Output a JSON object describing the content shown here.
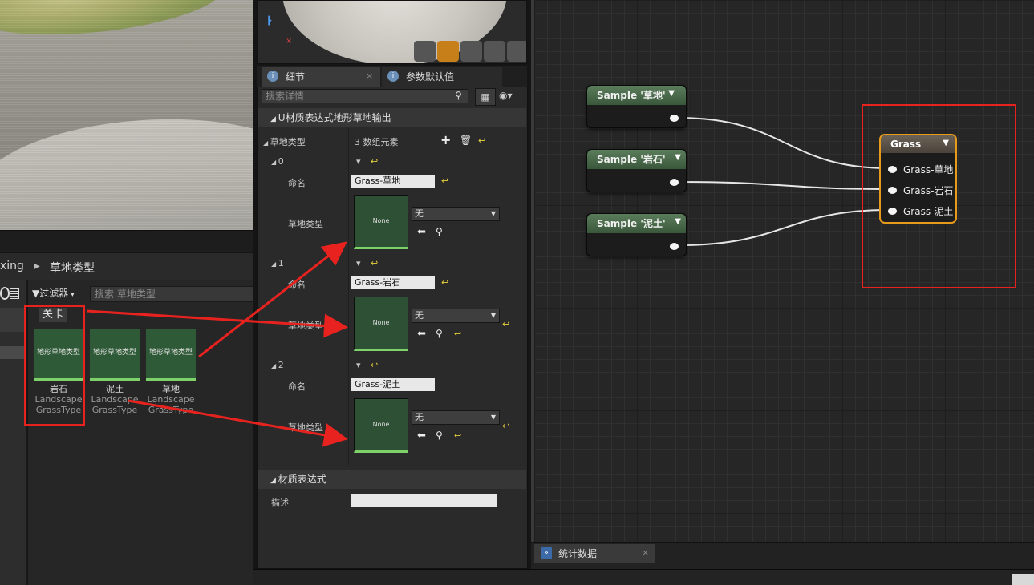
{
  "content_browser": {
    "path_prev": "xing",
    "path_current": "草地类型",
    "filter_label": "过滤器",
    "search_placeholder": "搜索 草地类型",
    "folder_tag": "关卡",
    "assets": [
      {
        "thumb_label": "地形草地类型",
        "name": "岩石",
        "type1": "Landscape",
        "type2": "GrassType"
      },
      {
        "thumb_label": "地形草地类型",
        "name": "泥土",
        "type1": "Landscape",
        "type2": "GrassType"
      },
      {
        "thumb_label": "地形草地类型",
        "name": "草地",
        "type1": "Landscape",
        "type2": "GrassType"
      }
    ]
  },
  "tabs": {
    "details": "细节",
    "defaults": "参数默认值"
  },
  "details": {
    "search_placeholder": "搜索详情",
    "section_title": "U材质表达式地形草地输出",
    "grass_types_label": "草地类型",
    "array_count": "3 数组元素",
    "name_label": "命名",
    "grass_type_label": "草地类型",
    "none_label": "None",
    "combo_value": "无",
    "elements": [
      {
        "index": "0",
        "name": "Grass-草地"
      },
      {
        "index": "1",
        "name": "Grass-岩石"
      },
      {
        "index": "2",
        "name": "Grass-泥土"
      }
    ],
    "material_section": "材质表达式",
    "desc_label": "描述"
  },
  "graph": {
    "sample_nodes": [
      "Sample '草地'",
      "Sample '岩石'",
      "Sample '泥土'"
    ],
    "output_node_title": "Grass",
    "output_pins": [
      "Grass-草地",
      "Grass-岩石",
      "Grass-泥土"
    ]
  },
  "stats_tab": "统计数据",
  "colors": {
    "accent_orange": "#e89a1a",
    "annotation_red": "#e8231f",
    "node_green": "#4a6b4a",
    "thumb_green": "#2f5a37"
  }
}
